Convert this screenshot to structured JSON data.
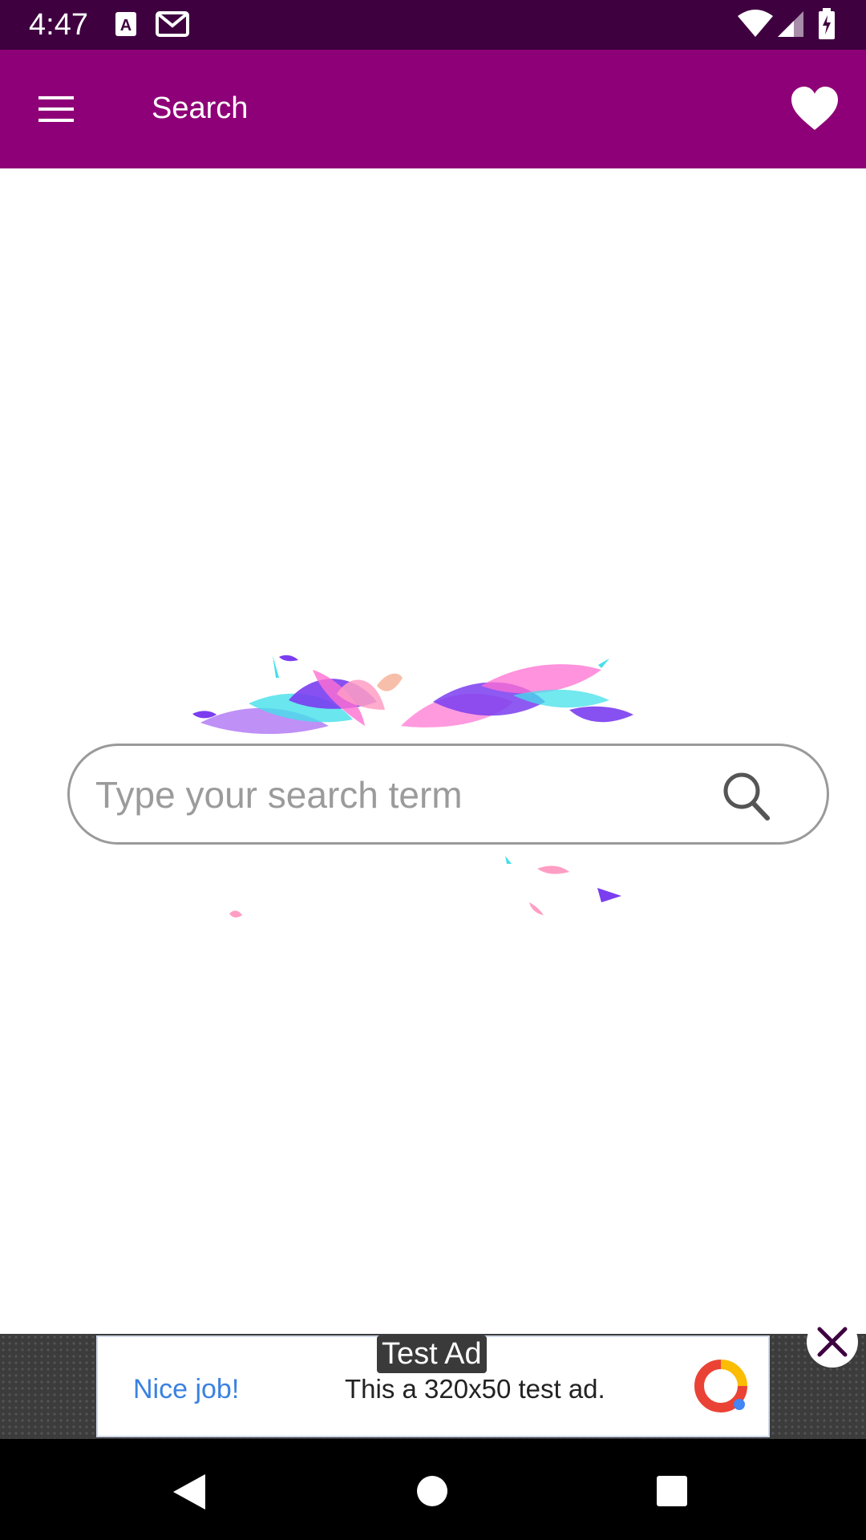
{
  "status_bar": {
    "time": "4:47",
    "icons": [
      "a-notification-icon",
      "gmail-icon",
      "wifi-icon",
      "cell-signal-icon",
      "battery-charging-icon"
    ]
  },
  "app_bar": {
    "title": "Search",
    "menu_icon": "hamburger-menu-icon",
    "favorite_icon": "heart-icon"
  },
  "search": {
    "placeholder": "Type your search term",
    "value": "",
    "icon": "search-icon"
  },
  "ad": {
    "tag": "Test Ad",
    "nice": "Nice job!",
    "text": "This a 320x50 test ad.",
    "close_icon": "close-icon"
  },
  "nav_bar": {
    "back_icon": "back-triangle-icon",
    "home_icon": "home-circle-icon",
    "recents_icon": "recents-square-icon"
  },
  "colors": {
    "status_bar": "#3f0040",
    "app_bar": "#8e0077",
    "ad_link": "#3b82e0"
  }
}
